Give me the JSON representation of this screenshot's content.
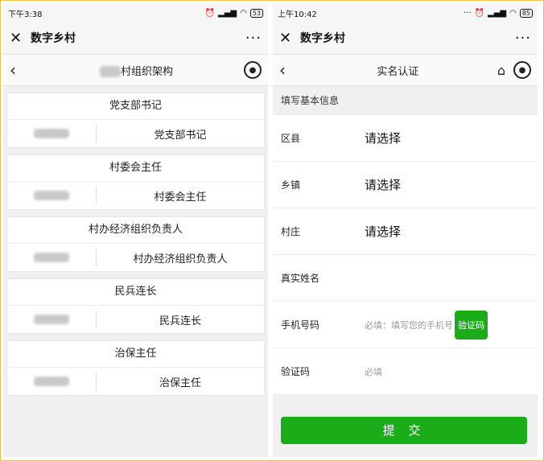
{
  "left": {
    "status": {
      "time": "下午3:38",
      "battery": "53"
    },
    "wx": {
      "close": "✕",
      "title": "数字乡村",
      "more": "···"
    },
    "nav": {
      "back": "‹",
      "title": "村组织架构"
    },
    "roles": [
      {
        "role": "党支部书记",
        "position": "党支部书记"
      },
      {
        "role": "村委会主任",
        "position": "村委会主任"
      },
      {
        "role": "村办经济组织负责人",
        "position": "村办经济组织负责人"
      },
      {
        "role": "民兵连长",
        "position": "民兵连长"
      },
      {
        "role": "治保主任",
        "position": "治保主任"
      }
    ]
  },
  "right": {
    "status": {
      "time": "上午10:42",
      "battery": "85"
    },
    "wx": {
      "close": "✕",
      "title": "数字乡村",
      "more": "···"
    },
    "nav": {
      "back": "‹",
      "title": "实名认证"
    },
    "section": "填写基本信息",
    "fields": [
      {
        "label": "区县",
        "value": "请选择"
      },
      {
        "label": "乡镇",
        "value": "请选择"
      },
      {
        "label": "村庄",
        "value": "请选择"
      },
      {
        "label": "真实姓名",
        "value": ""
      }
    ],
    "phone": {
      "label": "手机号码",
      "placeholder": "必填：填写您的手机号",
      "button": "验证码"
    },
    "code": {
      "label": "验证码",
      "placeholder": "必填"
    },
    "submit": "提 交"
  }
}
